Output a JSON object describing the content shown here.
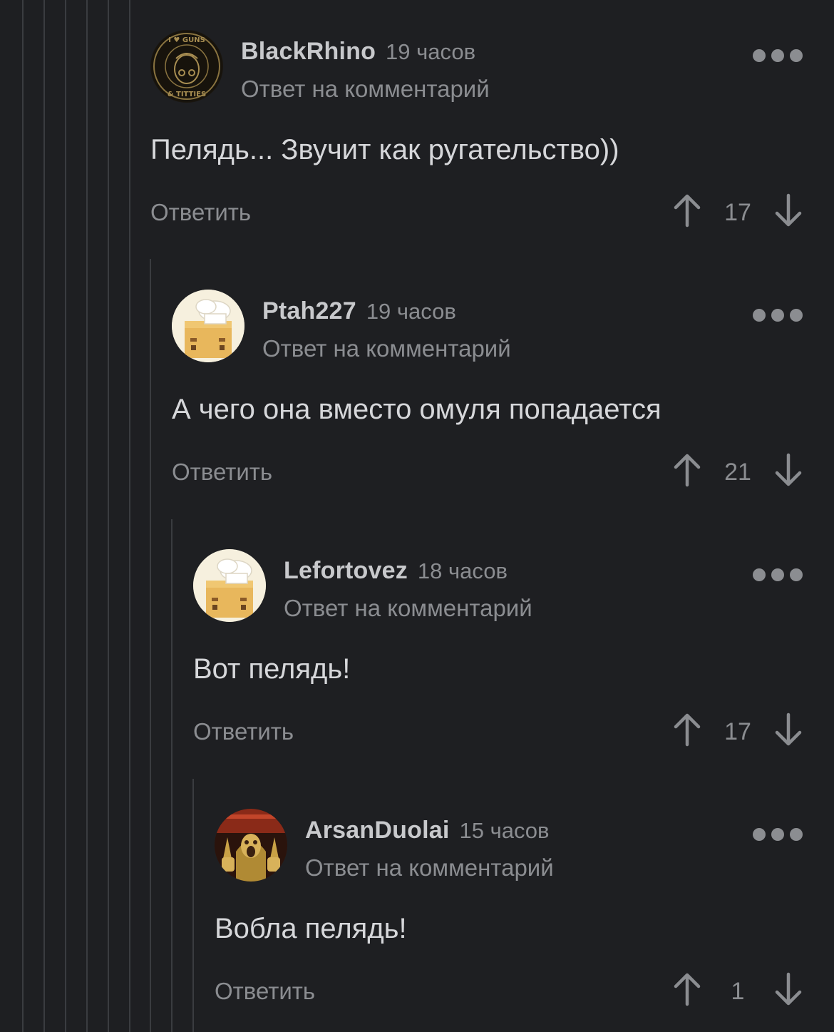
{
  "comments": [
    {
      "username": "BlackRhino",
      "time": "19 часов",
      "reply_to": "Ответ на комментарий",
      "text": "Пелядь... Звучит как ругательство))",
      "reply_label": "Ответить",
      "votes": "17",
      "avatar_text": [
        "I ♥ GUNS",
        "& TITTIES"
      ]
    },
    {
      "username": "Ptah227",
      "time": "19 часов",
      "reply_to": "Ответ на комментарий",
      "text": "А чего она вместо омуля попадается",
      "reply_label": "Ответить",
      "votes": "21"
    },
    {
      "username": "Lefortovez",
      "time": "18 часов",
      "reply_to": "Ответ на комментарий",
      "text": "Вот пелядь!",
      "reply_label": "Ответить",
      "votes": "17"
    },
    {
      "username": "ArsanDuolai",
      "time": "15 часов",
      "reply_to": "Ответ на комментарий",
      "text": "Вобла пелядь!",
      "reply_label": "Ответить",
      "votes": "1"
    }
  ],
  "colors": {
    "background": "#1e1f22",
    "thread_line": "#3a3c40",
    "username": "#c8c9cc",
    "secondary": "#8b8d91",
    "body_text": "#d6d7da"
  }
}
